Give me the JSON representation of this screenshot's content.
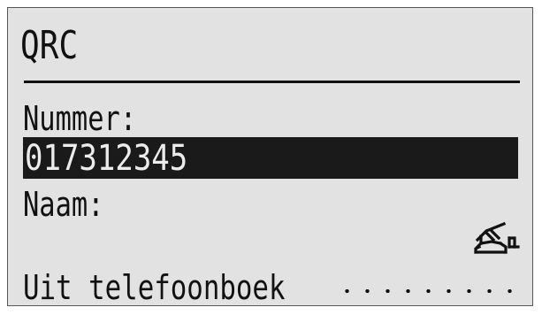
{
  "screen": {
    "title": "QRC",
    "number_label": "Nummer:",
    "number_value": "017312345",
    "name_label": "Naam:",
    "name_value": "",
    "phonebook_option": "Uit telefoonboek",
    "phonebook_icon": "phone-handset-icon"
  },
  "colors": {
    "lcd_background": "#e2e2e2",
    "ink": "#111111",
    "highlight_background": "#1a1a1a",
    "highlight_text": "#ececec"
  }
}
